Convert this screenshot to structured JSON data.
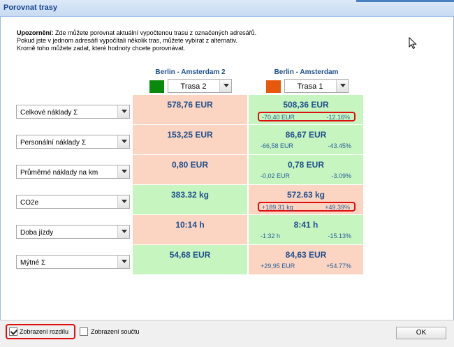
{
  "window": {
    "title": "Porovnat trasy"
  },
  "warning": {
    "label": "Upozornění:",
    "line1": " Zde můžete porovnat aktuální vypočtenou trasu z označených adresářů.",
    "line2": "Pokud jste v jednom adresáři vypočítali několik tras, můžete vybírat z alternativ.",
    "line3": "Kromě toho můžete zadat, které hodnoty chcete porovnávat."
  },
  "routes": [
    {
      "name": "Berlin - Amsterdam 2",
      "color": "#0a8a0a",
      "select": "Trasa 2"
    },
    {
      "name": "Berlin - Amsterdam",
      "color": "#e8580c",
      "select": "Trasa 1"
    }
  ],
  "rows": [
    {
      "metric": "Celkové náklady Σ",
      "v1": "578,76 EUR",
      "v2": "508,36 EUR",
      "d_abs": "-70,40 EUR",
      "d_pct": "-12.16%"
    },
    {
      "metric": "Personální náklady Σ",
      "v1": "153,25 EUR",
      "v2": "86,67 EUR",
      "d_abs": "-66,58 EUR",
      "d_pct": "-43.45%"
    },
    {
      "metric": "Průměrné náklady na km",
      "v1": "0,80 EUR",
      "v2": "0,78 EUR",
      "d_abs": "-0,02 EUR",
      "d_pct": "-3.09%"
    },
    {
      "metric": "CO2e",
      "v1": "383.32 kg",
      "v2": "572.63 kg",
      "d_abs": "+189.31 kg",
      "d_pct": "+49.39%"
    },
    {
      "metric": "Doba jízdy",
      "v1": "10:14 h",
      "v2": "8:41 h",
      "d_abs": "-1:32 h",
      "d_pct": "-15.13%"
    },
    {
      "metric": "Mýtné Σ",
      "v1": "54,68 EUR",
      "v2": "84,63 EUR",
      "d_abs": "+29,95 EUR",
      "d_pct": "+54.77%"
    }
  ],
  "footer": {
    "show_diff": "Zobrazení rozdílu",
    "show_sum": "Zobrazení součtu",
    "ok": "OK"
  }
}
